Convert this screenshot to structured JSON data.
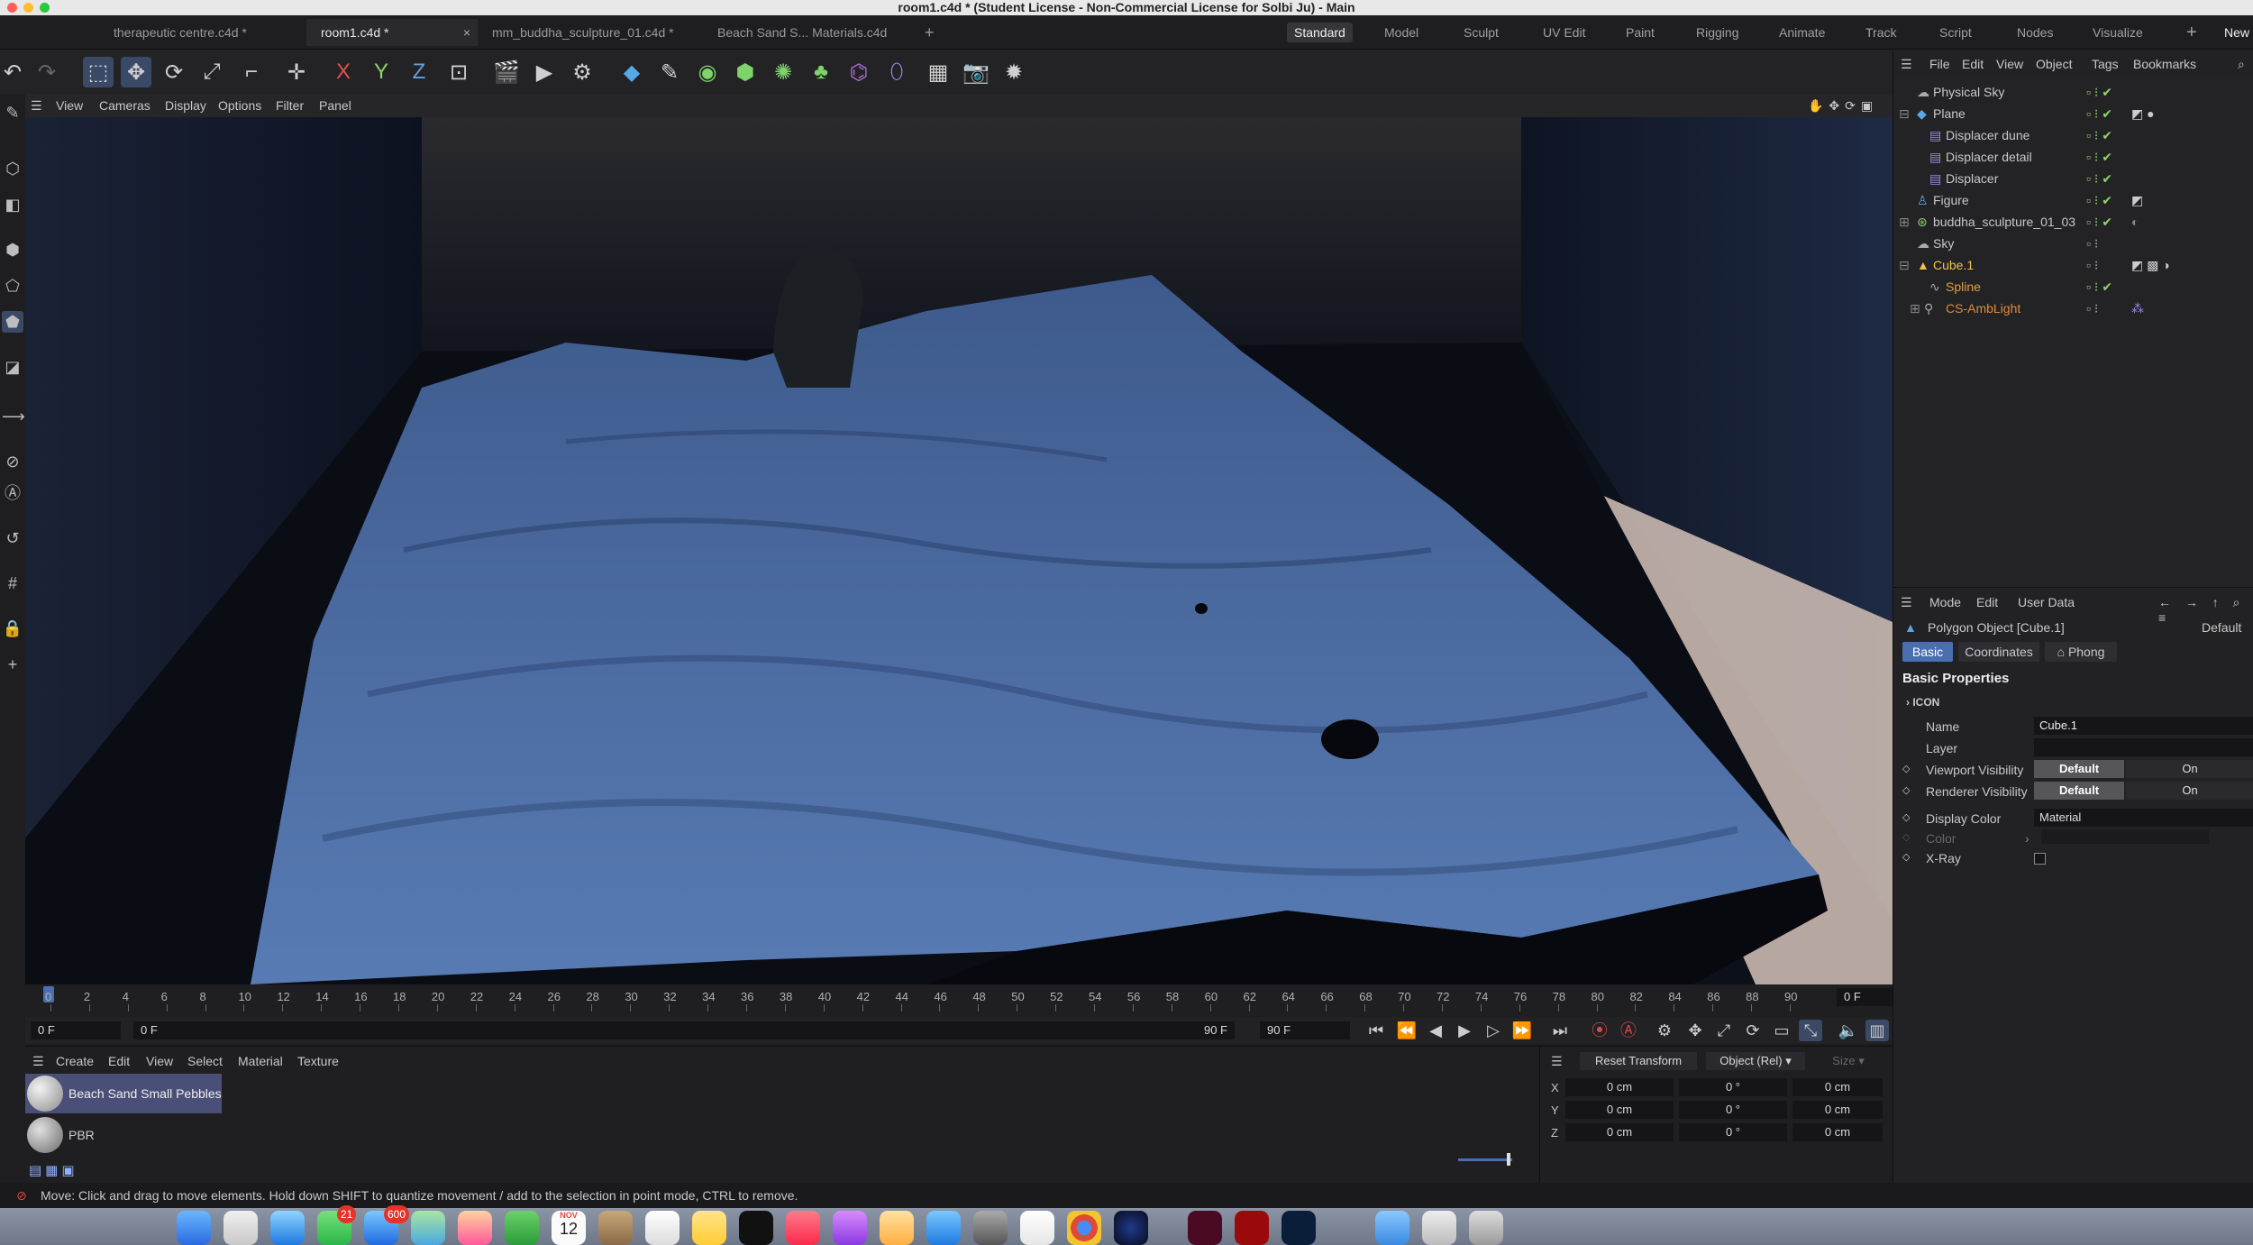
{
  "window": {
    "title": "room1.c4d * (Student License - Non-Commercial License for Solbi Ju) - Main"
  },
  "doc_tabs": [
    {
      "label": "therapeutic centre.c4d *"
    },
    {
      "label": "room1.c4d *"
    },
    {
      "label": "mm_buddha_sculpture_01.c4d *"
    },
    {
      "label": "Beach Sand  S... Materials.c4d"
    }
  ],
  "workspaces": [
    "Standard",
    "Model",
    "Sculpt",
    "UV Edit",
    "Paint",
    "Rigging",
    "Animate",
    "Track",
    "Script",
    "Nodes",
    "Visualize"
  ],
  "new_label": "New",
  "axis_lock": {
    "x": "X",
    "y": "Y",
    "z": "Z"
  },
  "viewport_menu": [
    "View",
    "Cameras",
    "Display",
    "Options",
    "Filter",
    "Panel"
  ],
  "timeline": {
    "ticks": [
      "0",
      "2",
      "4",
      "6",
      "8",
      "10",
      "12",
      "14",
      "16",
      "18",
      "20",
      "22",
      "24",
      "26",
      "28",
      "30",
      "32",
      "34",
      "36",
      "38",
      "40",
      "42",
      "44",
      "46",
      "48",
      "50",
      "52",
      "54",
      "56",
      "58",
      "60",
      "62",
      "64",
      "66",
      "68",
      "70",
      "72",
      "74",
      "76",
      "78",
      "80",
      "82",
      "84",
      "86",
      "88",
      "90"
    ],
    "current_frame": "0 F",
    "start": "0 F",
    "start2": "0 F",
    "end": "90 F",
    "end2": "90 F"
  },
  "material_menu": [
    "Create",
    "Edit",
    "View",
    "Select",
    "Material",
    "Texture"
  ],
  "materials": [
    {
      "name": "Beach Sand  Small Pebbles"
    },
    {
      "name": "PBR"
    }
  ],
  "coords": {
    "reset_label": "Reset Transform",
    "mode": "Object (Rel)",
    "size_label": "Size",
    "rows": [
      {
        "axis": "X",
        "pos": "0 cm",
        "rot": "0 °",
        "size": "0 cm"
      },
      {
        "axis": "Y",
        "pos": "0 cm",
        "rot": "0 °",
        "size": "0 cm"
      },
      {
        "axis": "Z",
        "pos": "0 cm",
        "rot": "0 °",
        "size": "0 cm"
      }
    ]
  },
  "status": {
    "text": "Move: Click and drag to move elements. Hold down SHIFT to quantize movement / add to the selection in point mode, CTRL to remove."
  },
  "object_manager": {
    "menu": [
      "File",
      "Edit",
      "View",
      "Object",
      "Tags",
      "Bookmarks"
    ],
    "objects": [
      {
        "name": "Physical Sky",
        "color": "#c8c8c8"
      },
      {
        "name": "Plane",
        "color": "#c8c8c8"
      },
      {
        "name": "Displacer dune",
        "color": "#c8c8c8"
      },
      {
        "name": "Displacer detail",
        "color": "#c8c8c8"
      },
      {
        "name": "Displacer",
        "color": "#c8c8c8"
      },
      {
        "name": "Figure",
        "color": "#c8c8c8"
      },
      {
        "name": "buddha_sculpture_01_03",
        "color": "#c8c8c8"
      },
      {
        "name": "Sky",
        "color": "#c8c8c8"
      },
      {
        "name": "Cube.1",
        "color": "#f0c24a"
      },
      {
        "name": "Spline",
        "color": "#e0a040"
      },
      {
        "name": "CS-AmbLight",
        "color": "#e08a3a"
      }
    ]
  },
  "attributes": {
    "menu": [
      "Mode",
      "Edit",
      "User Data"
    ],
    "object_title": "Polygon Object [Cube.1]",
    "default_label": "Default",
    "tabs": [
      "Basic",
      "Coordinates",
      "Phong"
    ],
    "section": "Basic Properties",
    "icon_group": "ICON",
    "fields": {
      "name_label": "Name",
      "name_value": "Cube.1",
      "layer_label": "Layer",
      "viewport_label": "Viewport Visibility",
      "viewport_value": "Default",
      "viewport_on": "On",
      "renderer_label": "Renderer Visibility",
      "renderer_value": "Default",
      "renderer_on": "On",
      "display_color_label": "Display Color",
      "display_color_value": "Material",
      "color_label": "Color",
      "xray_label": "X-Ray"
    }
  },
  "dock": {
    "messages_badge": "21",
    "mail_badge": "600",
    "calendar_month": "NOV",
    "calendar_day": "12"
  }
}
